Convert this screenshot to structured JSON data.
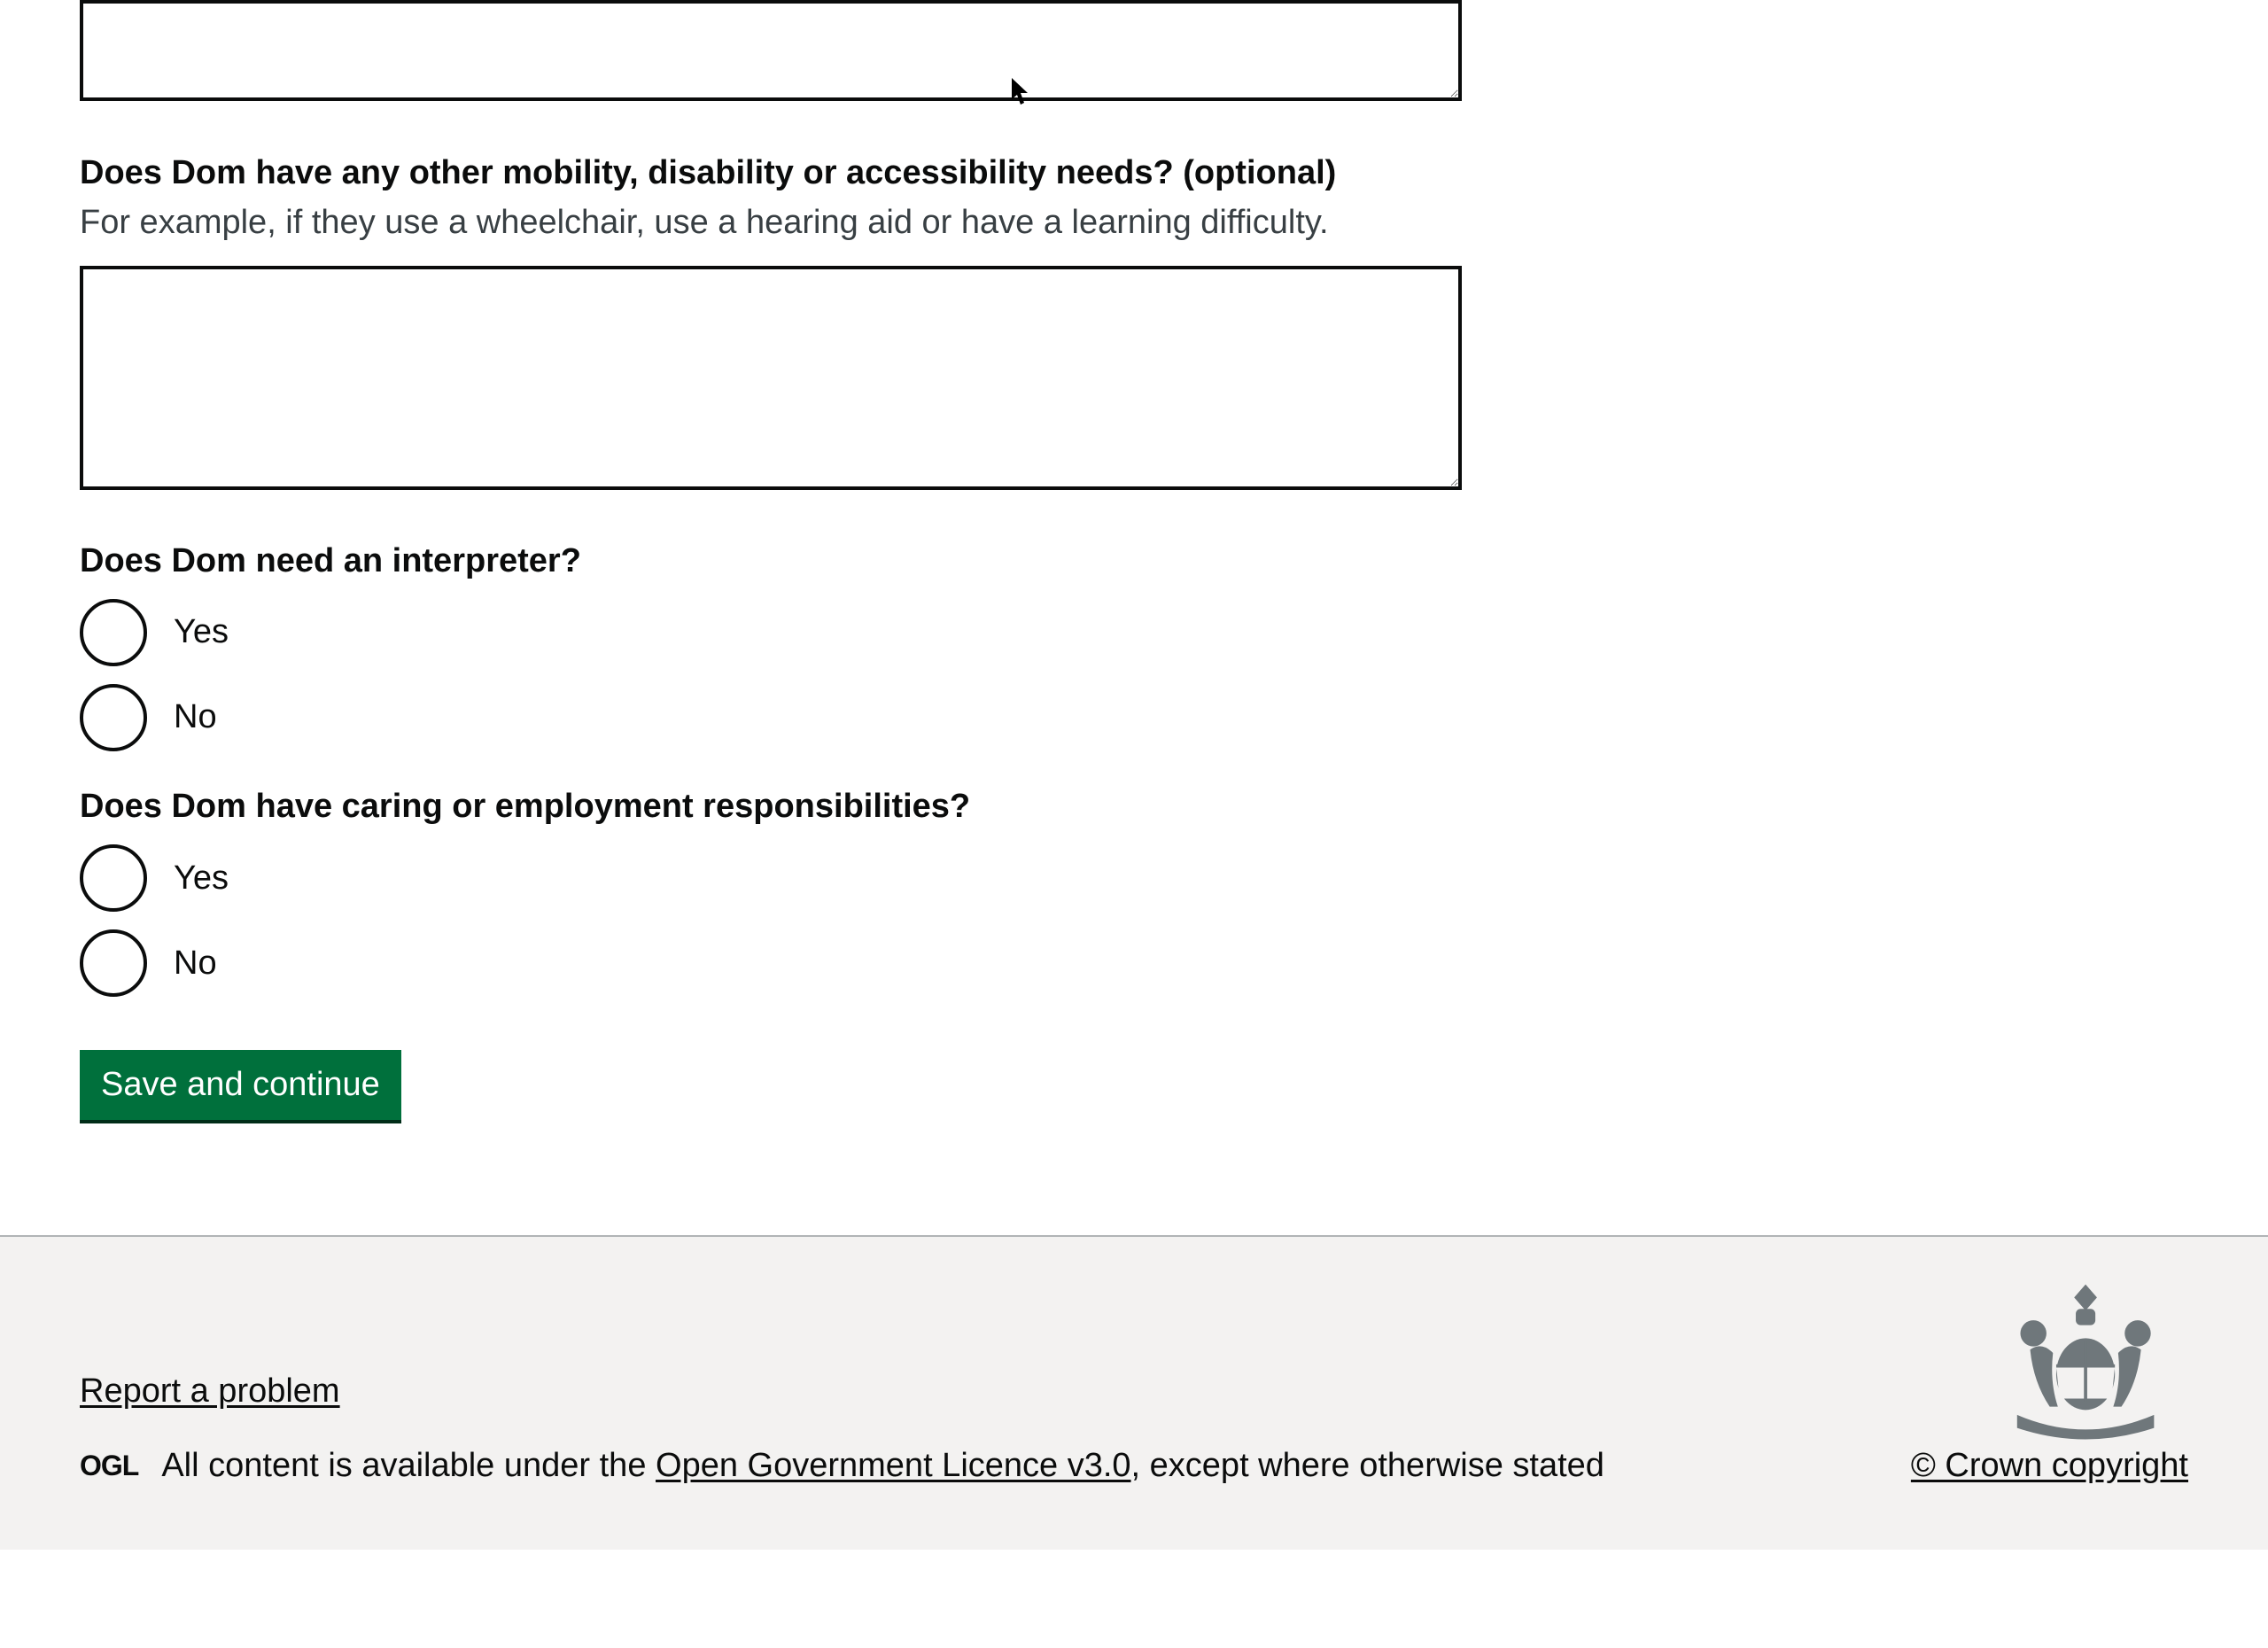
{
  "form": {
    "textarea_partial_value": "",
    "mobility": {
      "label": "Does Dom have any other mobility, disability or accessibility needs? (optional)",
      "hint": "For example, if they use a wheelchair, use a hearing aid or have a learning difficulty.",
      "value": ""
    },
    "interpreter": {
      "legend": "Does Dom need an interpreter?",
      "options": {
        "yes": "Yes",
        "no": "No"
      }
    },
    "caring": {
      "legend": "Does Dom have caring or employment responsibilities?",
      "options": {
        "yes": "Yes",
        "no": "No"
      }
    },
    "submit_label": "Save and continue"
  },
  "footer": {
    "report_link": "Report a problem",
    "ogl_prefix": "OGL",
    "licence_prefix": "All content is available under the ",
    "licence_link": "Open Government Licence v3.0",
    "licence_suffix": ", except where otherwise stated",
    "crown_copyright": "© Crown copyright"
  }
}
